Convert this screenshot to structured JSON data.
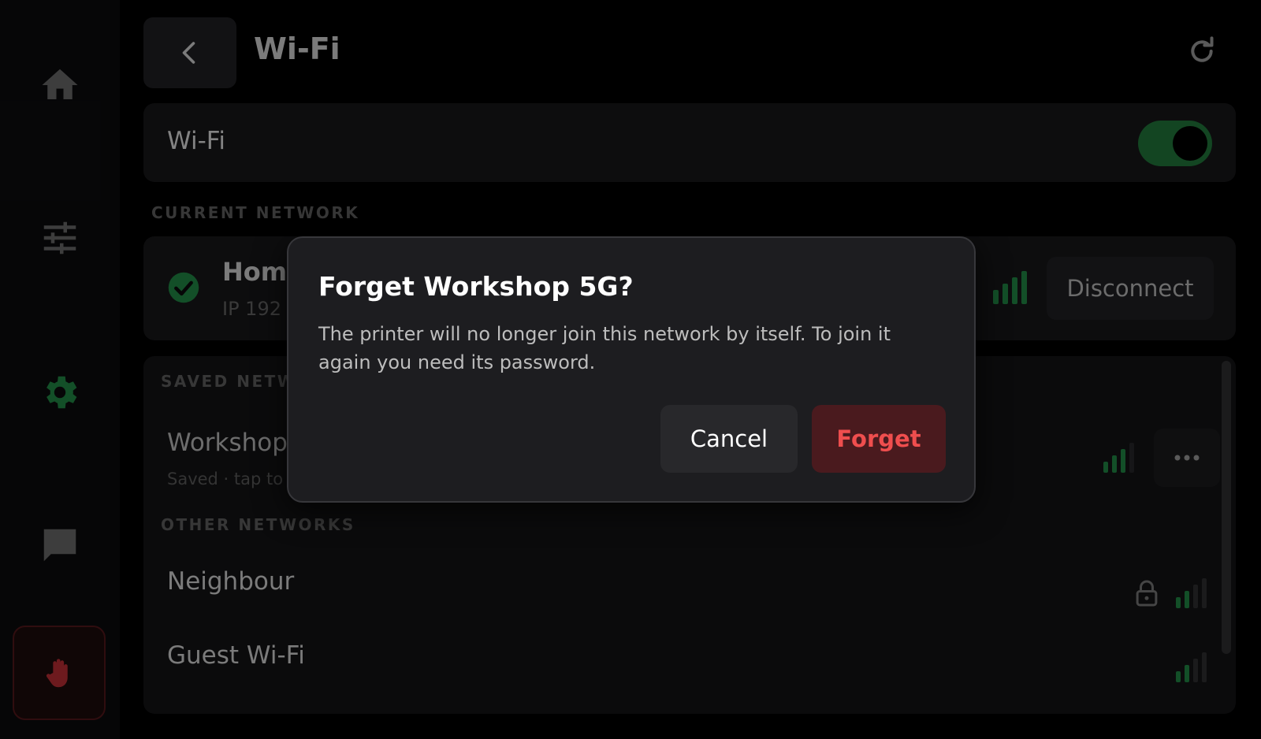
{
  "app": {
    "accent_color": "#1e6a35",
    "danger_color": "#ef4e4e"
  },
  "sidebar": {
    "items": [
      {
        "icon": "home-icon"
      },
      {
        "icon": "sliders-icon"
      },
      {
        "icon": "gear-icon",
        "active": true
      },
      {
        "icon": "chat-icon"
      }
    ],
    "emergency_stop_icon": "hand-stop-icon"
  },
  "header": {
    "title": "Wi-Fi",
    "back_icon": "chevron-left-icon",
    "refresh_icon": "refresh-icon"
  },
  "wifi_toggle": {
    "label": "Wi-Fi",
    "enabled": true
  },
  "current_network": {
    "section_label": "CURRENT NETWORK",
    "name": "Home",
    "ip": "IP  192",
    "signal_bars": 4,
    "disconnect_label": "Disconnect"
  },
  "saved_networks": {
    "section_label": "SAVED NETW",
    "items": [
      {
        "name": "Workshop",
        "status": "Saved · tap to",
        "signal_bars": 3
      }
    ]
  },
  "other_networks": {
    "section_label": "OTHER NETWORKS",
    "items": [
      {
        "name": "Neighbour",
        "locked": true,
        "signal_bars": 2
      },
      {
        "name": "Guest Wi-Fi",
        "locked": false,
        "signal_bars": 2
      }
    ]
  },
  "dialog": {
    "title": "Forget Workshop 5G?",
    "body": "The printer will no longer join this network by itself. To join it again you need its password.",
    "cancel_label": "Cancel",
    "confirm_label": "Forget"
  }
}
